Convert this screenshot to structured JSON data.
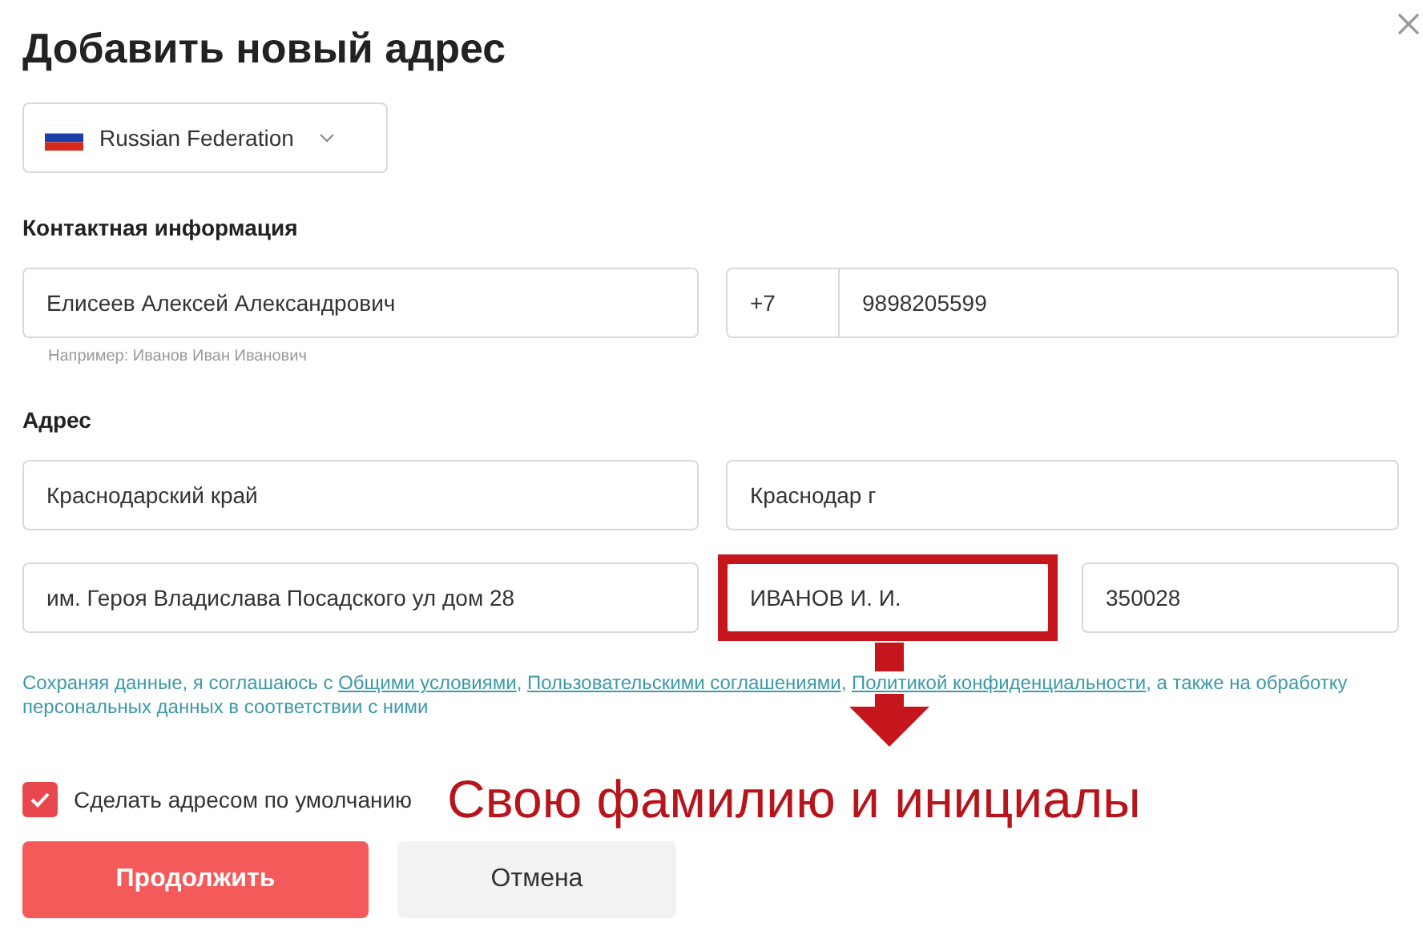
{
  "dialog": {
    "title": "Добавить новый адрес",
    "country": "Russian Federation"
  },
  "contact": {
    "heading": "Контактная информация",
    "name_value": "Елисеев Алексей Александрович",
    "name_hint": "Например: Иванов Иван Иванович",
    "phone_prefix": "+7",
    "phone_value": "9898205599"
  },
  "address": {
    "heading": "Адрес",
    "fields": [
      {
        "value": "Краснодарский край",
        "highlighted": false
      },
      {
        "value": "Краснодар г",
        "highlighted": false
      },
      {
        "value": "им. Героя Владислава Посадского ул дом 28",
        "highlighted": false
      },
      {
        "value": "ИВАНОВ И. И.",
        "highlighted": true
      },
      {
        "value": "350028",
        "highlighted": false
      }
    ]
  },
  "consent": {
    "parts": [
      {
        "kind": "text",
        "text": "Сохраняя данные, я соглашаюсь с "
      },
      {
        "kind": "link",
        "text": "Общими условиями"
      },
      {
        "kind": "text",
        "text": ", "
      },
      {
        "kind": "link",
        "text": "Пользовательскими соглашениями"
      },
      {
        "kind": "text",
        "text": ", "
      },
      {
        "kind": "link",
        "text": "Политикой конфиденциальности"
      },
      {
        "kind": "text",
        "text": ", а также на обработку персональных данных в соответствии с ними"
      }
    ]
  },
  "default_address": {
    "label": "Сделать адресом по умолчанию",
    "checked": true
  },
  "annotation": {
    "text": "Свою фамилию и инициалы"
  },
  "buttons": {
    "continue": "Продолжить",
    "cancel": "Отмена"
  }
}
